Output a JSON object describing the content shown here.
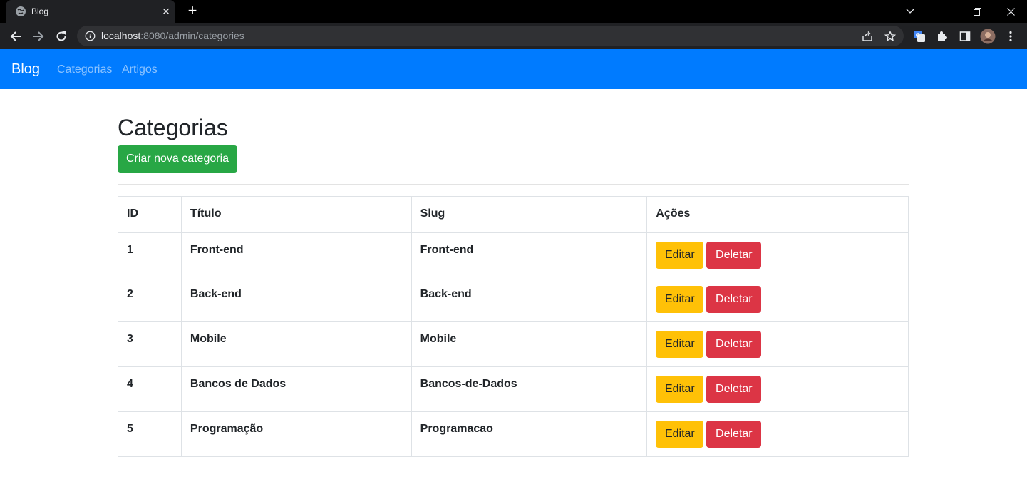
{
  "browser": {
    "tab_title": "Blog",
    "url_host": "localhost",
    "url_rest": ":8080/admin/categories"
  },
  "navbar": {
    "brand": "Blog",
    "links": [
      "Categorias",
      "Artigos"
    ]
  },
  "page": {
    "title": "Categorias",
    "create_button": "Criar nova categoria"
  },
  "table": {
    "headers": [
      "ID",
      "Título",
      "Slug",
      "Ações"
    ],
    "rows": [
      {
        "id": "1",
        "title": "Front-end",
        "slug": "Front-end"
      },
      {
        "id": "2",
        "title": "Back-end",
        "slug": "Back-end"
      },
      {
        "id": "3",
        "title": "Mobile",
        "slug": "Mobile"
      },
      {
        "id": "4",
        "title": "Bancos de Dados",
        "slug": "Bancos-de-Dados"
      },
      {
        "id": "5",
        "title": "Programação",
        "slug": "Programacao"
      }
    ],
    "edit_label": "Editar",
    "delete_label": "Deletar"
  },
  "colors": {
    "navbar": "#007bff",
    "success": "#28a745",
    "warning": "#ffc107",
    "danger": "#dc3545"
  }
}
